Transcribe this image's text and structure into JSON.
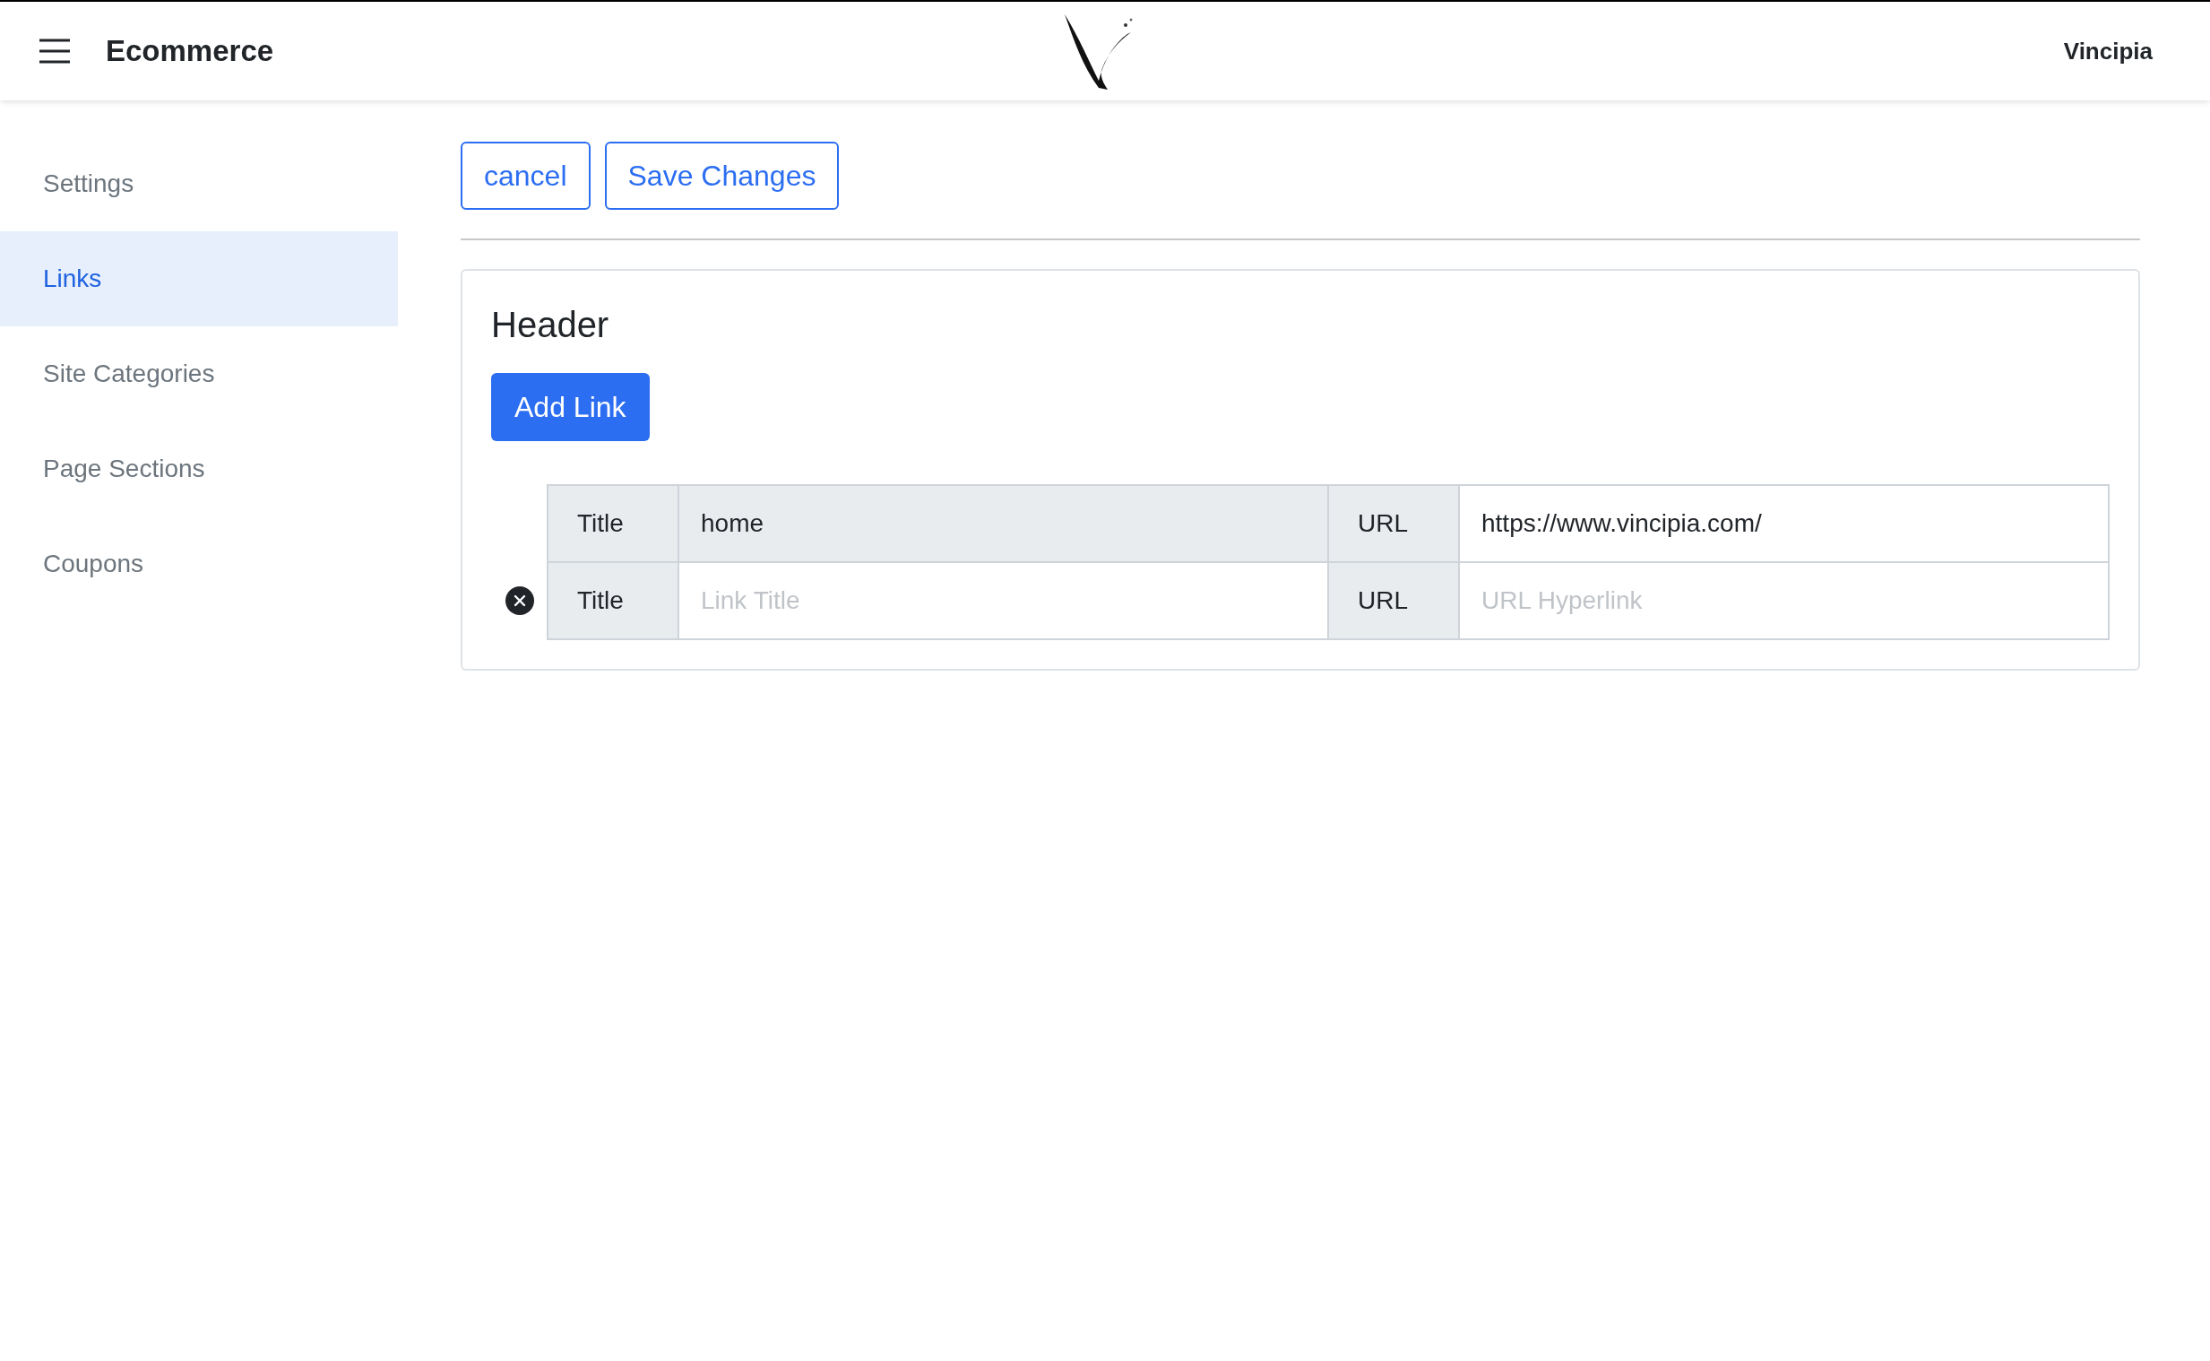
{
  "navbar": {
    "brand": "Ecommerce",
    "account": "Vincipia"
  },
  "sidebar": {
    "items": [
      {
        "label": "Settings",
        "selected": false
      },
      {
        "label": "Links",
        "selected": true
      },
      {
        "label": "Site Categories",
        "selected": false
      },
      {
        "label": "Page Sections",
        "selected": false
      },
      {
        "label": "Coupons",
        "selected": false
      }
    ]
  },
  "toolbar": {
    "buttons": [
      "cancel",
      "Save Changes"
    ]
  },
  "section": {
    "title": "Header",
    "add_button": "Add Link",
    "links": [
      {
        "title_label": "Title",
        "title_value": "home",
        "title_disabled": true,
        "url_label": "URL",
        "url_value": "https://www.vincipia.com/",
        "removable": false
      },
      {
        "title_label": "Title",
        "title_placeholder": "Link Title",
        "title_disabled": false,
        "url_label": "URL",
        "url_placeholder": "URL Hyperlink",
        "removable": true
      }
    ]
  }
}
